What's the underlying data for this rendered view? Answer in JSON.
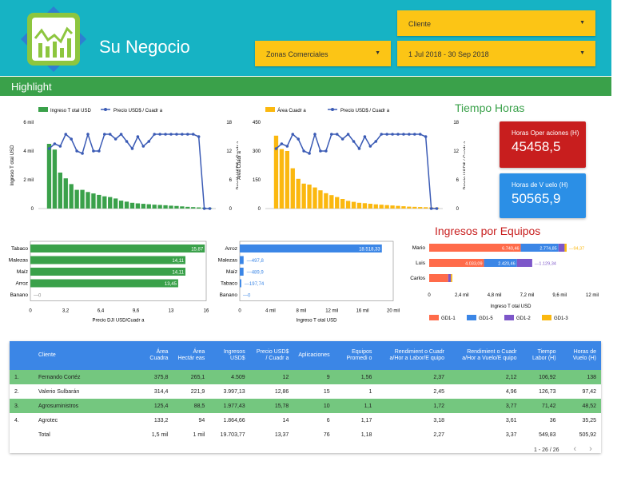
{
  "header": {
    "title": "Su Negocio"
  },
  "filters": {
    "cliente": "Cliente",
    "zonas": "Zonas Comerciales",
    "fecha": "1 Jul 2018 - 30 Sep 2018"
  },
  "band": {
    "label": "Highlight"
  },
  "colors": {
    "green": "#3aa14a",
    "blue": "#3b5bb5",
    "amber": "#fbb80f",
    "red": "#c81e1e",
    "kpiblue": "#2b8fe6",
    "teal": "#16b3c4"
  },
  "tiempo": {
    "title": "Tiempo Horas",
    "kpi1_label": "Horas Oper aciones (H)",
    "kpi1_value": "45458,5",
    "kpi2_label": "Horas de V uelo (H)",
    "kpi2_value": "50565,9"
  },
  "ingresos_title": "Ingresos por Equipos",
  "chart_data": [
    {
      "type": "bar+line",
      "legend": [
        "Ingreso T otal USD",
        "Precio USD$ / Cuadr a"
      ],
      "ylabel": "Ingreso T otal USD",
      "y2label": "Precio USD$ / Cuadr a",
      "yticks": [
        "6 mil",
        "4 mil",
        "2 mil",
        "0"
      ],
      "y2ticks": [
        "18",
        "12",
        "6",
        "0"
      ],
      "ylim": [
        0,
        6000
      ],
      "y2lim": [
        0,
        18
      ],
      "bars": [
        4500,
        4100,
        2500,
        2100,
        1700,
        1300,
        1300,
        1150,
        1050,
        950,
        850,
        800,
        700,
        550,
        480,
        400,
        360,
        330,
        300,
        270,
        250,
        230,
        200,
        180,
        150,
        120,
        100,
        80,
        60,
        40
      ],
      "line": [
        12.5,
        13.5,
        13,
        15.5,
        14.5,
        12,
        11.5,
        15.5,
        12,
        12,
        15.5,
        15.5,
        14.5,
        15.5,
        14,
        12.5,
        15,
        13,
        14,
        15.5,
        15.5,
        15.5,
        15.5,
        15.5,
        15.5,
        15.5,
        15.5,
        15,
        0,
        0
      ]
    },
    {
      "type": "bar+line",
      "legend": [
        "Área Cuadr a",
        "Precio USD$ / Cuadr a"
      ],
      "ylabel": "Área Cuadr a",
      "y2label": "Precio USD$ / Cuadr a",
      "yticks": [
        "450",
        "300",
        "150",
        "0"
      ],
      "y2ticks": [
        "18",
        "12",
        "6",
        "0"
      ],
      "ylim": [
        0,
        450
      ],
      "y2lim": [
        0,
        18
      ],
      "bars": [
        380,
        310,
        300,
        210,
        155,
        130,
        125,
        110,
        95,
        80,
        70,
        60,
        50,
        40,
        35,
        30,
        28,
        25,
        22,
        20,
        18,
        16,
        14,
        12,
        10,
        9,
        8,
        7,
        6,
        5
      ],
      "line": [
        12.5,
        13.5,
        13,
        15.5,
        14.5,
        12,
        11.5,
        15.5,
        12,
        12,
        15.5,
        15.5,
        14.5,
        15.5,
        14,
        12.5,
        15,
        13,
        14,
        15.5,
        15.5,
        15.5,
        15.5,
        15.5,
        15.5,
        15.5,
        15.5,
        15,
        0,
        0
      ]
    },
    {
      "type": "hbar",
      "categories": [
        "Tabaco",
        "Malezas",
        "Maíz",
        "Arroz",
        "Banano"
      ],
      "values": [
        15.87,
        14.11,
        14.11,
        13.45,
        0
      ],
      "labels": [
        "15,87",
        "14,11",
        "14,11",
        "13,45",
        "0"
      ],
      "xticks": [
        "0",
        "3,2",
        "6,4",
        "9,6",
        "13",
        "16"
      ],
      "xlim": [
        0,
        16
      ],
      "xlabel": "Precio DJI USD/Cuadr a"
    },
    {
      "type": "hbar",
      "categories": [
        "Arroz",
        "Malezas",
        "Maíz",
        "Tabaco",
        "Banano"
      ],
      "values": [
        18518.33,
        497.8,
        489.9,
        197.74,
        0
      ],
      "labels": [
        "18.518,33",
        "497,8",
        "489,9",
        "197,74",
        "0"
      ],
      "xticks": [
        "0",
        "4 mil",
        "8 mil",
        "12 mil",
        "16 mil",
        "20 mil"
      ],
      "xlim": [
        0,
        20000
      ],
      "xlabel": "Ingreso T otal USD"
    },
    {
      "type": "stacked-hbar",
      "categories": [
        "Mario",
        "Luis",
        "Carlos"
      ],
      "series": [
        {
          "name": "GD1-1",
          "color": "#ff6b4a",
          "values": [
            6740.46,
            4033.09,
            1400
          ]
        },
        {
          "name": "GD1-5",
          "color": "#3b86e6",
          "values": [
            2774.85,
            2420.46,
            0
          ]
        },
        {
          "name": "GD1-2",
          "color": "#7d57c9",
          "values": [
            450,
            1129.34,
            200
          ]
        },
        {
          "name": "GD1-3",
          "color": "#fbb80f",
          "values": [
            150,
            0,
            100
          ]
        }
      ],
      "labels": [
        [
          "6.740,46",
          "2.774,85",
          "",
          "94,37"
        ],
        [
          "4.033,09",
          "2.420,46",
          "1.129,34",
          ""
        ],
        [
          "",
          "",
          "",
          ""
        ]
      ],
      "xticks": [
        "0",
        "2,4 mil",
        "4,8 mil",
        "7,2 mil",
        "9,6 mil",
        "12 mil"
      ],
      "xlim": [
        0,
        12000
      ],
      "xlabel": "Ingreso T otal USD"
    }
  ],
  "table": {
    "headers": [
      "",
      "Cliente",
      "Área Cuadra",
      "Área Hectár eas",
      "Ingresos USD$",
      "Precio USD$ / Cuadr a",
      "Aplicaciones",
      "Equipos Promedi o",
      "Rendimient o Cuadr a/Hor a Labor/E quipo",
      "Rendimient o Cuadr a/Hor a Vuelo/E quipo",
      "Tiempo Labor (H)",
      "Horas de Vuelo (H)"
    ],
    "rows": [
      [
        "1.",
        "Fernando Cortéz",
        "375,8",
        "265,1",
        "4.509",
        "12",
        "9",
        "1,56",
        "2,37",
        "2,12",
        "106,92",
        "138"
      ],
      [
        "2.",
        "Valerio Sulbarán",
        "314,4",
        "221,9",
        "3.997,13",
        "12,86",
        "15",
        "1",
        "2,45",
        "4,96",
        "126,73",
        "97,42"
      ],
      [
        "3.",
        "Agrosuministros",
        "125,4",
        "88,5",
        "1.977,43",
        "15,78",
        "10",
        "1,1",
        "1,72",
        "3,77",
        "71,42",
        "48,52"
      ],
      [
        "4.",
        "Agrotec",
        "133,2",
        "94",
        "1.864,66",
        "14",
        "6",
        "1,17",
        "3,18",
        "3,61",
        "36",
        "35,25"
      ],
      [
        "",
        "Total",
        "1,5 mil",
        "1 mil",
        "19.703,77",
        "13,37",
        "76",
        "1,18",
        "2,27",
        "3,37",
        "549,83",
        "505,92"
      ]
    ],
    "pagination": "1 - 26 / 26"
  }
}
